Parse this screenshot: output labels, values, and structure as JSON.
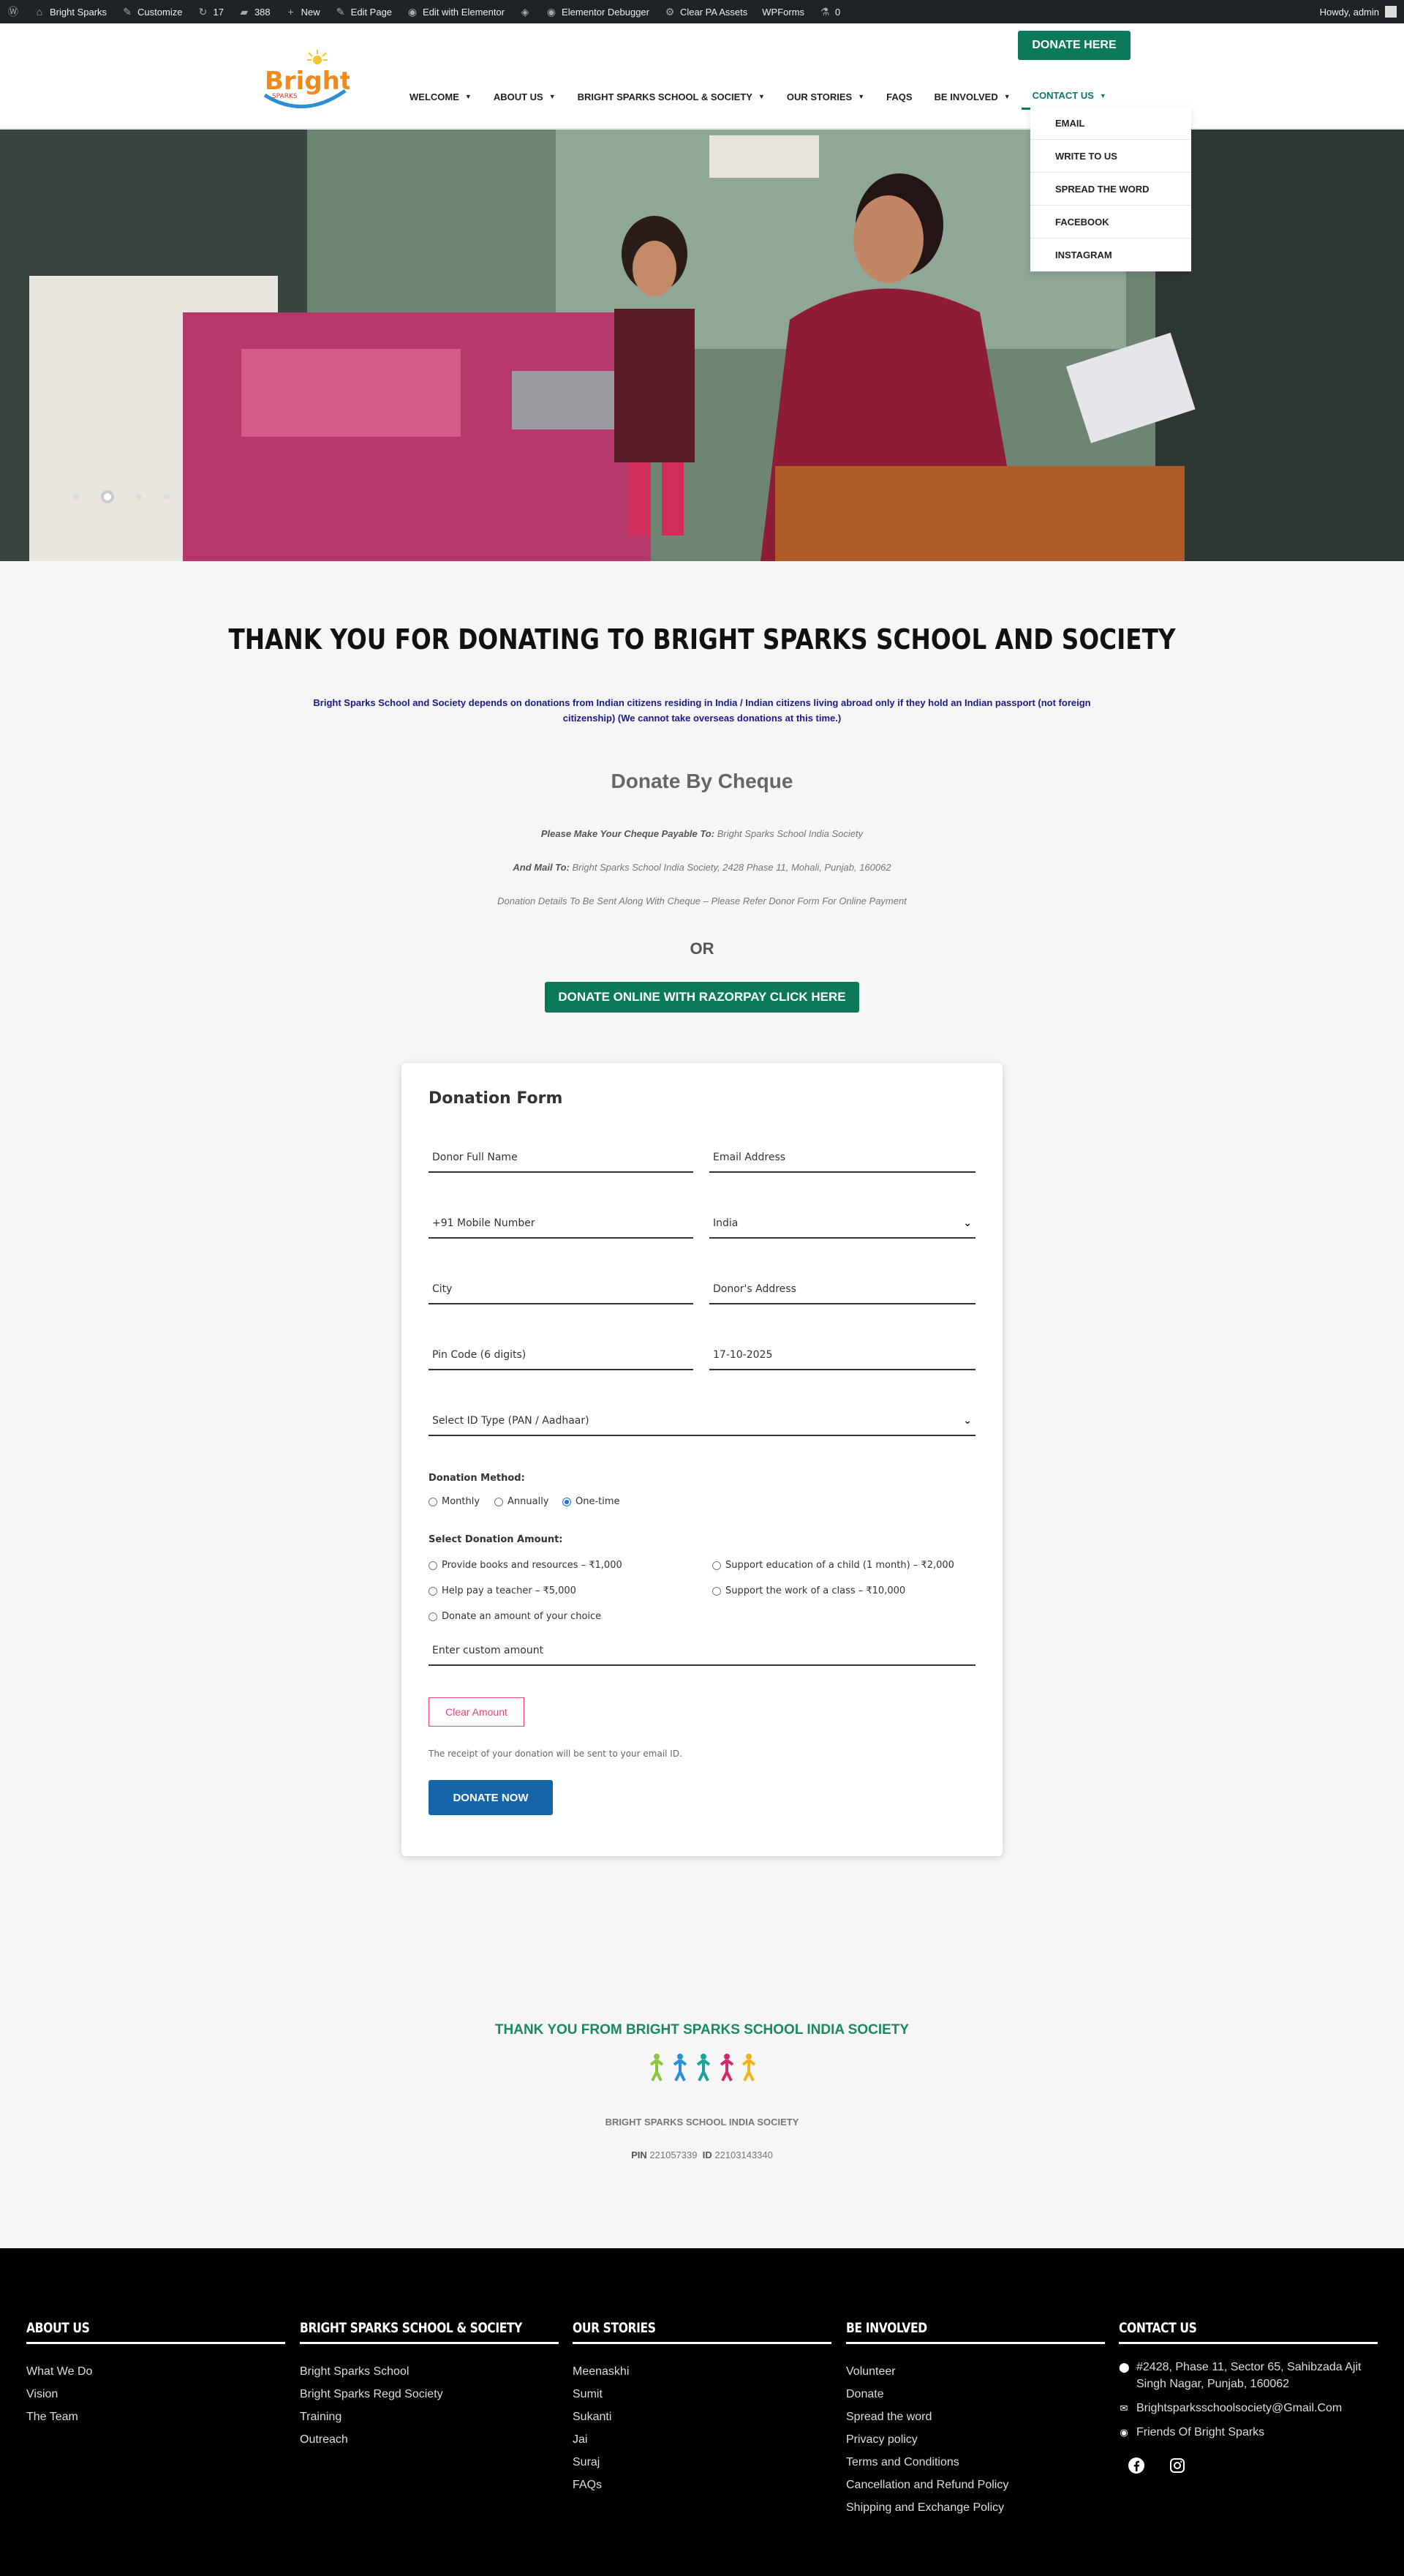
{
  "adminbar": {
    "items": [
      {
        "icon": "wordpress-icon",
        "label": ""
      },
      {
        "icon": "home-icon",
        "label": "Bright Sparks"
      },
      {
        "icon": "brush-icon",
        "label": "Customize"
      },
      {
        "icon": "updates-icon",
        "label": "17"
      },
      {
        "icon": "comments-icon",
        "label": "388"
      },
      {
        "icon": "plus-icon",
        "label": "New"
      },
      {
        "icon": "pencil-icon",
        "label": "Edit Page"
      },
      {
        "icon": "elementor-icon",
        "label": "Edit with Elementor"
      },
      {
        "icon": "diamond-icon",
        "label": ""
      },
      {
        "icon": "elementor-icon",
        "label": "Elementor Debugger"
      },
      {
        "icon": "gear-icon",
        "label": "Clear PA Assets"
      },
      {
        "icon": "",
        "label": "WPForms"
      },
      {
        "icon": "flask-icon",
        "label": "0"
      }
    ],
    "howdy": "Howdy, admin"
  },
  "header": {
    "logo_text": "Bright",
    "logo_sub": "SPARKS",
    "donate_here": "DONATE HERE",
    "nav": [
      {
        "label": "WELCOME",
        "caret": true
      },
      {
        "label": "ABOUT US",
        "caret": true
      },
      {
        "label": "BRIGHT SPARKS SCHOOL & SOCIETY",
        "caret": true
      },
      {
        "label": "OUR STORIES",
        "caret": true
      },
      {
        "label": "FAQS",
        "caret": false
      },
      {
        "label": "BE INVOLVED",
        "caret": true
      },
      {
        "label": "CONTACT US",
        "caret": true
      }
    ],
    "contact_dropdown": [
      "EMAIL",
      "WRITE TO US",
      "SPREAD THE WORD",
      "FACEBOOK",
      "INSTAGRAM"
    ]
  },
  "hero": {
    "slides": 4,
    "active_slide": 1
  },
  "main": {
    "title": "THANK YOU FOR DONATING TO BRIGHT SPARKS SCHOOL AND SOCIETY",
    "notice": "Bright Sparks School and Society depends on donations from Indian citizens residing in India / Indian citizens living abroad only if they hold an Indian passport (not foreign citizenship) (We cannot take overseas donations at this time.)",
    "cheque_title": "Donate By Cheque",
    "payable_label": "Please Make Your Cheque Payable To:",
    "payable_value": "Bright Sparks School India Society",
    "mail_label": "And Mail To:",
    "mail_value": "Bright Sparks School India Society, 2428 Phase 11, Mohali, Punjab, 160062",
    "details_note": "Donation Details To Be Sent Along With Cheque – Please Refer Donor Form For Online Payment",
    "or": "OR",
    "razorpay_button": "DONATE ONLINE WITH RAZORPAY CLICK HERE"
  },
  "form": {
    "title": "Donation Form",
    "full_name": "Donor Full Name",
    "email": "Email Address",
    "mobile": "+91 Mobile Number",
    "country": "India",
    "city": "City",
    "address": "Donor's Address",
    "pin": "Pin Code (6 digits)",
    "date": "17-10-2025",
    "id_type": "Select ID Type (PAN / Aadhaar)",
    "method_label": "Donation Method:",
    "methods": [
      {
        "label": "Monthly",
        "checked": false
      },
      {
        "label": "Annually",
        "checked": false
      },
      {
        "label": "One-time",
        "checked": true
      }
    ],
    "amount_label": "Select Donation Amount:",
    "amounts": [
      "Provide books and resources – ₹1,000",
      "Support education of a child (1 month) – ₹2,000",
      "Help pay a teacher – ₹5,000",
      "Support the work of a class – ₹10,000",
      "Donate an amount of your choice"
    ],
    "custom_amount": "Enter custom amount",
    "clear_button": "Clear Amount",
    "receipt_note": "The receipt of your donation will be sent to your email ID.",
    "donate_button": "DONATE NOW"
  },
  "thanks": {
    "title": "THANK YOU FROM BRIGHT SPARKS SCHOOL INDIA SOCIETY",
    "society": "BRIGHT SPARKS SCHOOL INDIA SOCIETY",
    "pin_label": "PIN",
    "pin_value": "221057339",
    "id_label": "ID",
    "id_value": "22103143340"
  },
  "footer": {
    "about": {
      "heading": "ABOUT US",
      "links": [
        "What We Do",
        "Vision",
        "The Team"
      ]
    },
    "school": {
      "heading": "BRIGHT SPARKS SCHOOL & SOCIETY",
      "links": [
        "Bright Sparks School",
        "Bright Sparks Regd Society",
        "Training",
        "Outreach"
      ]
    },
    "stories": {
      "heading": "OUR STORIES",
      "links": [
        "Meenaskhi",
        "Sumit",
        "Sukanti",
        "Jai",
        "Suraj",
        "FAQs"
      ]
    },
    "involved": {
      "heading": "BE INVOLVED",
      "links": [
        "Volunteer",
        "Donate",
        "Spread the word",
        "Privacy policy",
        "Terms and Conditions",
        "Cancellation and Refund Policy",
        "Shipping and Exchange Policy"
      ]
    },
    "contact": {
      "heading": "CONTACT US",
      "address": "#2428, Phase 11, Sector 65, Sahibzada Ajit Singh Nagar, Punjab, 160062",
      "email": "Brightsparksschoolsociety@Gmail.Com",
      "friends": "Friends Of Bright Sparks"
    }
  },
  "colors": {
    "brand_green": "#0c7a5a",
    "donate_blue": "#1565a8",
    "clear_pink": "#e0457b",
    "notice_blue": "#1a1a8a"
  }
}
